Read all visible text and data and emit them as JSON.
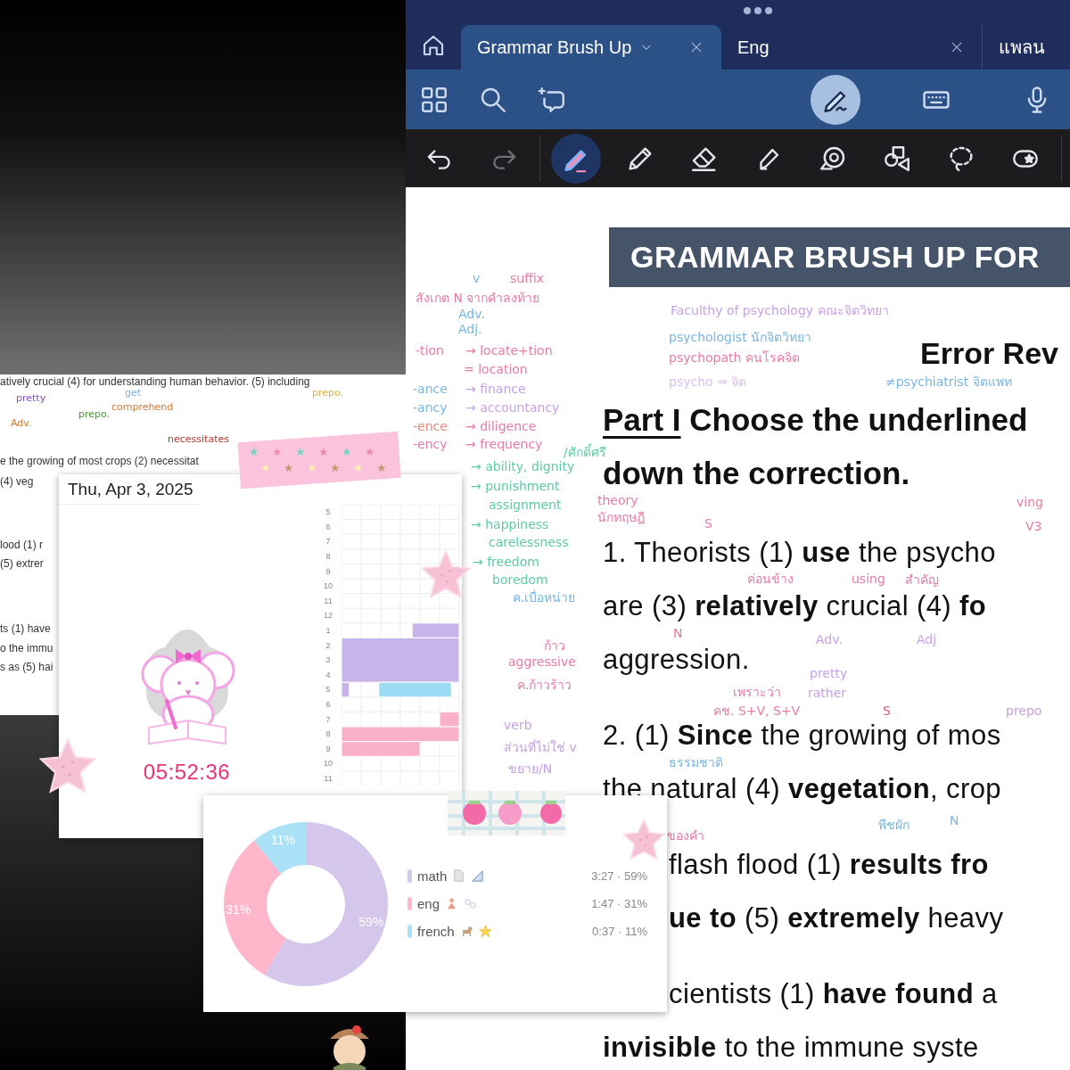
{
  "app": {
    "tabs": [
      {
        "label": "Grammar Brush Up",
        "selected": true,
        "menu": true,
        "closable": true
      },
      {
        "label": "Eng",
        "selected": false,
        "menu": false,
        "closable": true
      },
      {
        "label": "แพลน",
        "selected": false,
        "menu": false,
        "closable": false
      }
    ],
    "toolbar": [
      {
        "kind": "grid",
        "selected": false
      },
      {
        "kind": "search",
        "selected": false
      },
      {
        "kind": "ai-bubble",
        "selected": false
      },
      {
        "kind": "pen-scribble",
        "selected": true
      },
      {
        "kind": "keyboard",
        "selected": false
      },
      {
        "kind": "mic",
        "selected": false
      }
    ],
    "tools": [
      {
        "kind": "undo",
        "selected": false,
        "disabled": false
      },
      {
        "kind": "redo",
        "selected": false,
        "disabled": true
      },
      {
        "kind": "pen",
        "selected": true,
        "disabled": false
      },
      {
        "kind": "pencil",
        "selected": false,
        "disabled": false
      },
      {
        "kind": "eraser",
        "selected": false,
        "disabled": false
      },
      {
        "kind": "highlighter",
        "selected": false,
        "disabled": false
      },
      {
        "kind": "elements",
        "selected": false,
        "disabled": false
      },
      {
        "kind": "shapes",
        "selected": false,
        "disabled": false
      },
      {
        "kind": "lasso",
        "selected": false,
        "disabled": false
      },
      {
        "kind": "sticker",
        "selected": false,
        "disabled": false
      }
    ]
  },
  "document": {
    "banner": "GRAMMAR BRUSH UP FOR",
    "subtitle": "Error Rev",
    "heading": [
      [
        {
          "text": "Part I",
          "underlined": true
        },
        {
          "text": " Choose the underlined",
          "underlined": false
        }
      ],
      [
        {
          "text": "down the correction.",
          "underlined": false
        }
      ]
    ],
    "questions": [
      {
        "lines": [
          "1. Theorists (1) **use** the psycho",
          "are (3) **relatively** crucial (4) **fo**",
          "aggression."
        ]
      },
      {
        "lines": [
          "2. (1) **Since** the growing of mos",
          "the natural (4) **vegetation**, crop"
        ]
      },
      {
        "lines": [
          "flash flood (1) **results fro**",
          "**ue to** (5) **extremely** heavy"
        ]
      },
      {
        "lines": [
          "cientists (1) **have found** a",
          "**invisible** to the immune syste"
        ]
      }
    ],
    "margin_notes": [
      {
        "text": "v",
        "color": "#7ab6e0"
      },
      {
        "text": "suffix",
        "color": "#e57ca6"
      },
      {
        "text": "สังเกต N จากคำลงท้าย",
        "color": "#e57ca6"
      },
      {
        "text": "Adv.",
        "color": "#7ab6e0"
      },
      {
        "text": "Adj.",
        "color": "#7ab6e0"
      },
      {
        "text": "-tion",
        "color": "#e57ca6"
      },
      {
        "text": "→ locate+tion",
        "color": "#e57ca6"
      },
      {
        "text": "= location",
        "color": "#e57ca6"
      },
      {
        "text": "-ance",
        "color": "#7ab6e0"
      },
      {
        "text": "→ finance",
        "color": "#c6a2e6"
      },
      {
        "text": "-ancy",
        "color": "#7ab6e0"
      },
      {
        "text": "→ accountancy",
        "color": "#c6a2e6"
      },
      {
        "text": "-ence",
        "color": "#ef8a7a"
      },
      {
        "text": "→ diligence",
        "color": "#e57ca6"
      },
      {
        "text": "-ency",
        "color": "#e57ca6"
      },
      {
        "text": "→ frequency",
        "color": "#e57ca6"
      },
      {
        "text": "/ศักดิ์ศรี",
        "color": "#5fcaa6"
      },
      {
        "text": "→ ability, dignity",
        "color": "#5fcaa6"
      },
      {
        "text": "→ punishment",
        "color": "#5fcaa6"
      },
      {
        "text": "assignment",
        "color": "#5fcaa6"
      },
      {
        "text": "→ happiness",
        "color": "#5fcaa6"
      },
      {
        "text": "carelessness",
        "color": "#5fcaa6"
      },
      {
        "text": "→ freedom",
        "color": "#5fcaa6"
      },
      {
        "text": "boredom",
        "color": "#5fcaa6"
      },
      {
        "text": "ค.เบื่อหน่าย",
        "color": "#7ab6e0"
      },
      {
        "text": "ก้าว",
        "color": "#e57ca6"
      },
      {
        "text": "aggressive",
        "color": "#e57ca6"
      },
      {
        "text": "ค.ก้าวร้าว",
        "color": "#e57ca6"
      },
      {
        "text": "verb",
        "color": "#c6a2e6"
      },
      {
        "text": "ส่วนที่ไม่ใช่ v",
        "color": "#c6a2e6"
      },
      {
        "text": "ขยาย/N",
        "color": "#c6a2e6"
      }
    ],
    "notes": [
      {
        "text": "Faculthy of psychology คณะจิตวิทยา",
        "color": "#c6a2e6"
      },
      {
        "text": "psychologist นักจิตวิทยา",
        "color": "#7ab6e0"
      },
      {
        "text": "psychopath คนโรคจิต",
        "color": "#e57ca6"
      },
      {
        "text": "psycho ⇒ จิต",
        "color": "#d8c0ee"
      },
      {
        "text": "≠psychiatrist จิตแพท",
        "color": "#7ab6e0"
      },
      {
        "text": "theory",
        "color": "#e57ca6"
      },
      {
        "text": "ving",
        "color": "#e57ca6"
      },
      {
        "text": "นักทฤษฎี",
        "color": "#e57ca6"
      },
      {
        "text": "S",
        "color": "#e57ca6"
      },
      {
        "text": "V3",
        "color": "#e57ca6"
      },
      {
        "text": "ค่อนข้าง",
        "color": "#e57ca6"
      },
      {
        "text": "using",
        "color": "#e57ca6"
      },
      {
        "text": "สำคัญ",
        "color": "#e57ca6"
      },
      {
        "text": "N",
        "color": "#e57ca6"
      },
      {
        "text": "Adv.",
        "color": "#c6a2e6"
      },
      {
        "text": "Adj",
        "color": "#c6a2e6"
      },
      {
        "text": "pretty",
        "color": "#c6a2e6"
      },
      {
        "text": "เพราะว่า",
        "color": "#e57ca6"
      },
      {
        "text": "rather",
        "color": "#c6a2e6"
      },
      {
        "text": "คช. S+V, S+V",
        "color": "#e57ca6"
      },
      {
        "text": "S",
        "color": "#d9588f"
      },
      {
        "text": "prepo",
        "color": "#c6a2e6"
      },
      {
        "text": "ธรรมชาติ",
        "color": "#7ab6e0"
      },
      {
        "text": "N",
        "color": "#7ab6e0"
      },
      {
        "text": "พืชผัก",
        "color": "#7ab6e0"
      },
      {
        "text": "ของคำ",
        "color": "#e57ca6"
      }
    ]
  },
  "snippet": {
    "lines": [
      "atively crucial (4) for understanding human behavior. (5) including",
      "e the growing of most crops (2) necessitat",
      "(4) veg",
      "lood (1) r",
      "(5) extrer",
      "ts (1) have",
      "o the immu",
      "s as (5) hai"
    ],
    "notes": [
      {
        "text": "get",
        "color": "#7ab6e0"
      },
      {
        "text": "comprehend",
        "color": "#d07a3a"
      },
      {
        "text": "pretty",
        "color": "#8a4fc8"
      },
      {
        "text": "Adv.",
        "color": "#d07a3a"
      },
      {
        "text": "prepo.",
        "color": "#4a9a3a"
      },
      {
        "text": "necessitates",
        "color": "#b03a2a"
      },
      {
        "text": "prepo.",
        "color": "#e0b04a"
      }
    ]
  },
  "timer": {
    "date": "Thu, Apr 3, 2025",
    "time": "05:52:36",
    "hours": [
      "5",
      "6",
      "7",
      "8",
      "9",
      "10",
      "11",
      "12",
      "1",
      "2",
      "3",
      "4",
      "5",
      "6",
      "7",
      "8",
      "9",
      "10",
      "11"
    ]
  },
  "chart": {
    "chart_data": {
      "type": "donut",
      "categories": [
        "math",
        "eng",
        "french"
      ],
      "values": [
        59,
        31,
        11
      ],
      "value_labels": [
        "59%",
        "31%",
        "11%"
      ]
    },
    "legend": [
      {
        "color": "#d5c6ec",
        "reading": "3:27 · 59%"
      },
      {
        "color": "#ffb6ca",
        "reading": "1:47 · 31%"
      },
      {
        "color": "#a9e1f6",
        "reading": "0:37 · 11%"
      }
    ]
  }
}
